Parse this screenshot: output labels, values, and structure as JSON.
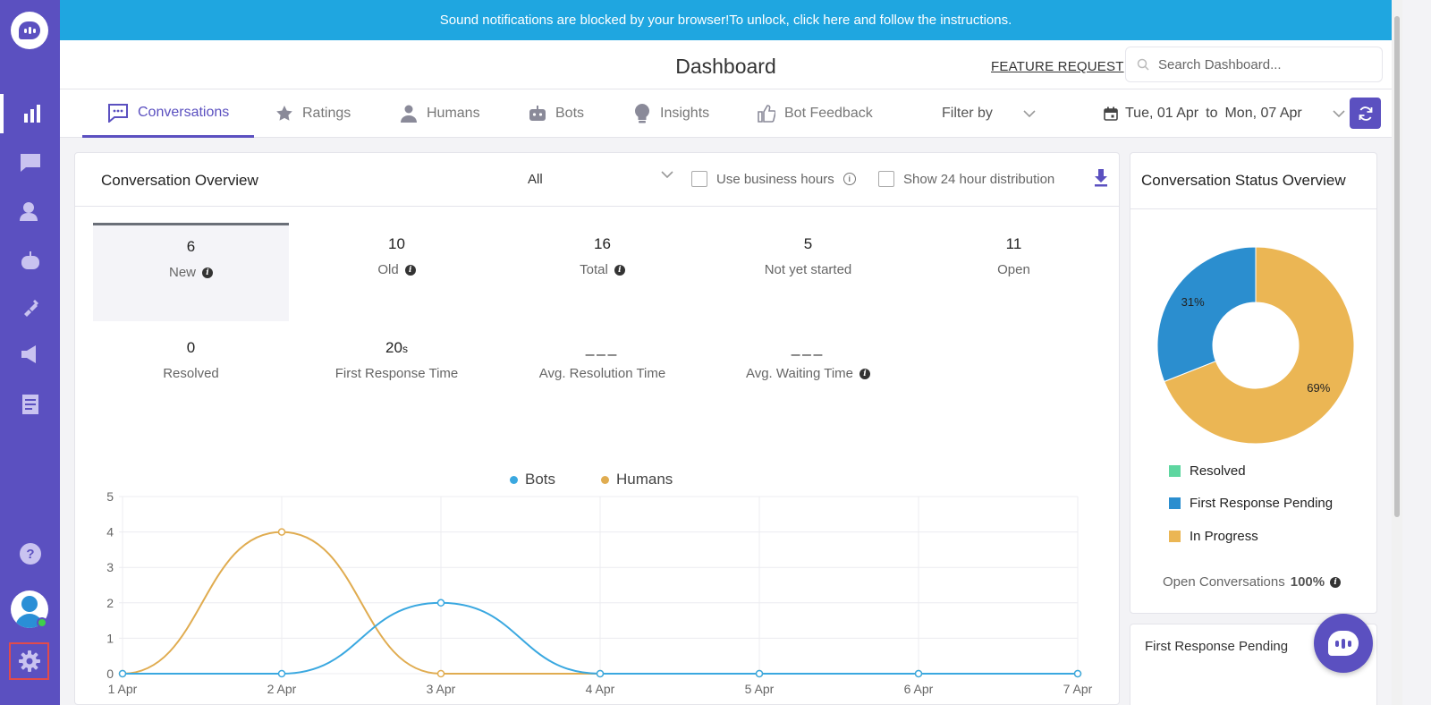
{
  "banner": {
    "text": "Sound notifications are blocked by your browser!To unlock, click here and follow the instructions."
  },
  "header": {
    "title": "Dashboard",
    "feature_request": "FEATURE REQUEST",
    "search_placeholder": "Search Dashboard..."
  },
  "sidebar": {
    "items": [
      "reports",
      "conversations",
      "contacts",
      "bots",
      "integrations",
      "campaigns",
      "articles",
      "help",
      "profile",
      "settings"
    ],
    "active": "reports"
  },
  "tabs": [
    {
      "label": "Conversations",
      "icon": "chat-icon",
      "active": true
    },
    {
      "label": "Ratings",
      "icon": "star-icon"
    },
    {
      "label": "Humans",
      "icon": "person-icon"
    },
    {
      "label": "Bots",
      "icon": "bot-icon"
    },
    {
      "label": "Insights",
      "icon": "bulb-icon"
    },
    {
      "label": "Bot Feedback",
      "icon": "thumbs-up-icon"
    }
  ],
  "filter": {
    "label": "Filter by"
  },
  "date_range": {
    "start": "Tue, 01 Apr",
    "sep": "to",
    "end": "Mon, 07 Apr"
  },
  "overview": {
    "title": "Conversation Overview",
    "selected_filter": "All",
    "business_hours_label": "Use business hours",
    "distribution_label": "Show 24 hour distribution",
    "metrics": [
      {
        "value": "6",
        "label": "New"
      },
      {
        "value": "10",
        "label": "Old"
      },
      {
        "value": "16",
        "label": "Total"
      },
      {
        "value": "5",
        "label": "Not yet started"
      },
      {
        "value": "11",
        "label": "Open"
      },
      {
        "value": "0",
        "label": "Resolved"
      },
      {
        "value": "20",
        "unit": "s",
        "label": "First Response Time"
      },
      {
        "value": "___",
        "label": "Avg. Resolution Time"
      },
      {
        "value": "___",
        "label": "Avg. Waiting Time"
      }
    ]
  },
  "chart_data": {
    "type": "line",
    "x": [
      "1 Apr",
      "2 Apr",
      "3 Apr",
      "4 Apr",
      "5 Apr",
      "6 Apr",
      "7 Apr"
    ],
    "ylim": [
      0,
      5
    ],
    "yticks": [
      0,
      1,
      2,
      3,
      4,
      5
    ],
    "series": [
      {
        "name": "Bots",
        "color": "#3aa8e0",
        "values": [
          0,
          0,
          2,
          0,
          0,
          0,
          0
        ]
      },
      {
        "name": "Humans",
        "color": "#e0ac50",
        "values": [
          0,
          4,
          0,
          0,
          0,
          0,
          0
        ]
      }
    ],
    "grid": true,
    "legend": "top-center"
  },
  "status_overview": {
    "title": "Conversation Status Overview",
    "chart_data": {
      "type": "pie",
      "slices": [
        {
          "label": "In Progress",
          "value": 69,
          "text": "69%",
          "color": "#ebb654"
        },
        {
          "label": "First Response Pending",
          "value": 31,
          "text": "31%",
          "color": "#2b8ecf"
        }
      ]
    },
    "legend": [
      {
        "label": "Resolved",
        "color": "#5ed6a0"
      },
      {
        "label": "First Response Pending",
        "color": "#2b8ecf"
      },
      {
        "label": "In Progress",
        "color": "#ebb654"
      }
    ],
    "footer_label": "Open Conversations",
    "footer_value": "100%"
  },
  "first_response_pending": {
    "title": "First Response Pending"
  }
}
